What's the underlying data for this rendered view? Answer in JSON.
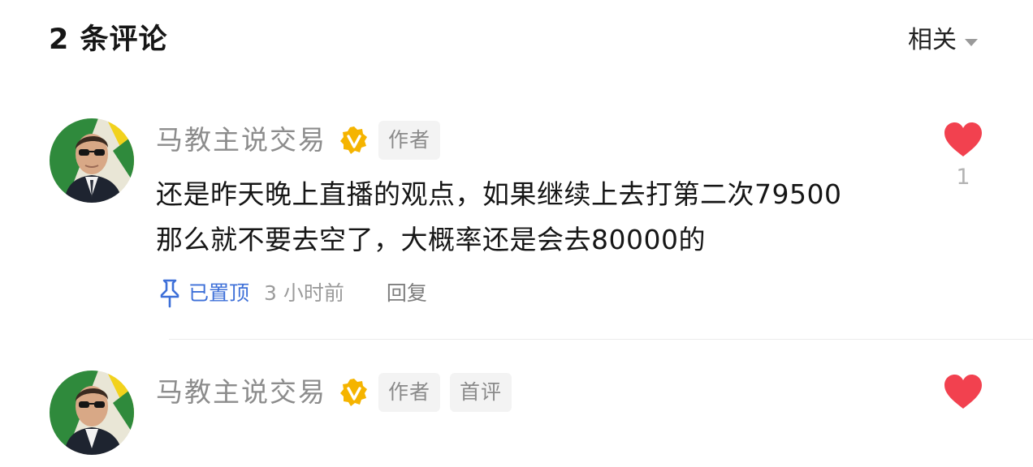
{
  "header": {
    "title": "2 条评论",
    "sort_label": "相关",
    "sort_icon": "caret-down-icon"
  },
  "colors": {
    "like_red": "#f2414f",
    "verified_gold": "#f5b400",
    "pinned_blue": "#3d6fd8"
  },
  "comments": [
    {
      "author": "马教主说交易",
      "verified_icon": "verified-v-badge-icon",
      "tags": [
        "作者"
      ],
      "lines": [
        "还是昨天晚上直播的观点，如果继续上去打第二次79500",
        "那么就不要去空了，大概率还是会去80000的"
      ],
      "pinned_label": "已置顶",
      "time": "3 小时前",
      "reply_label": "回复",
      "like_count": "1"
    },
    {
      "author": "马教主说交易",
      "verified_icon": "verified-v-badge-icon",
      "tags": [
        "作者",
        "首评"
      ]
    }
  ]
}
